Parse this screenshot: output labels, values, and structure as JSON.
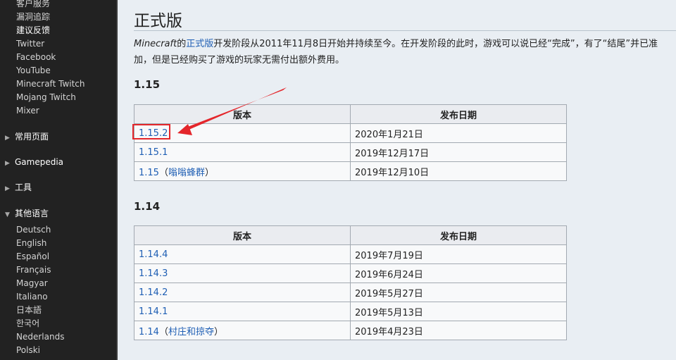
{
  "sidebar": {
    "links_top": [
      "客户服务",
      "漏洞追踪",
      "建议反馈",
      "Twitter",
      "Facebook",
      "YouTube",
      "Minecraft Twitch",
      "Mojang Twitch",
      "Mixer"
    ],
    "sections": [
      "常用页面",
      "Gamepedia",
      "工具",
      "其他语言"
    ],
    "languages": [
      "Deutsch",
      "English",
      "Español",
      "Français",
      "Magyar",
      "Italiano",
      "日本語",
      "한국어",
      "Nederlands",
      "Polski"
    ]
  },
  "content": {
    "title": "正式版",
    "intro": {
      "line1_em": "Minecraft",
      "line1_a": "的",
      "line1_link": "正式版",
      "line1_b": "开发阶段从2011年11月8日开始并持续至今。在开发阶段的此时，游戏可以说已经“完成”，有了“结尾”并已准",
      "line2": "加，但是已经购买了游戏的玩家无需付出额外费用。"
    },
    "sections": [
      {
        "heading": "1.15",
        "headers": [
          "版本",
          "发布日期"
        ],
        "rows": [
          {
            "version": "1.15.2",
            "note": "",
            "date": "2020年1月21日"
          },
          {
            "version": "1.15.1",
            "note": "",
            "date": "2019年12月17日"
          },
          {
            "version": "1.15",
            "note": "嗡嗡蜂群",
            "date": "2019年12月10日"
          }
        ]
      },
      {
        "heading": "1.14",
        "headers": [
          "版本",
          "发布日期"
        ],
        "rows": [
          {
            "version": "1.14.4",
            "note": "",
            "date": "2019年7月19日"
          },
          {
            "version": "1.14.3",
            "note": "",
            "date": "2019年6月24日"
          },
          {
            "version": "1.14.2",
            "note": "",
            "date": "2019年5月27日"
          },
          {
            "version": "1.14.1",
            "note": "",
            "date": "2019年5月13日"
          },
          {
            "version": "1.14",
            "note": "村庄和掠夺",
            "date": "2019年4月23日"
          }
        ]
      }
    ]
  },
  "colors": {
    "sidebar_bg": "#222222",
    "content_bg": "#e9eef3",
    "link": "#1f5fb4",
    "annotation": "#e4262b"
  }
}
